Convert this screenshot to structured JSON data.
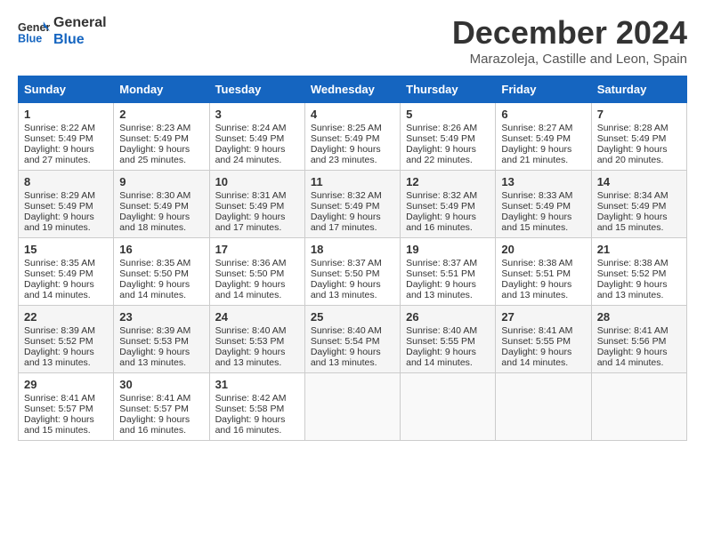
{
  "header": {
    "logo_line1": "General",
    "logo_line2": "Blue",
    "title": "December 2024",
    "subtitle": "Marazoleja, Castille and Leon, Spain"
  },
  "weekdays": [
    "Sunday",
    "Monday",
    "Tuesday",
    "Wednesday",
    "Thursday",
    "Friday",
    "Saturday"
  ],
  "weeks": [
    [
      {
        "day": "1",
        "sunrise": "8:22 AM",
        "sunset": "5:49 PM",
        "daylight": "9 hours and 27 minutes."
      },
      {
        "day": "2",
        "sunrise": "8:23 AM",
        "sunset": "5:49 PM",
        "daylight": "9 hours and 25 minutes."
      },
      {
        "day": "3",
        "sunrise": "8:24 AM",
        "sunset": "5:49 PM",
        "daylight": "9 hours and 24 minutes."
      },
      {
        "day": "4",
        "sunrise": "8:25 AM",
        "sunset": "5:49 PM",
        "daylight": "9 hours and 23 minutes."
      },
      {
        "day": "5",
        "sunrise": "8:26 AM",
        "sunset": "5:49 PM",
        "daylight": "9 hours and 22 minutes."
      },
      {
        "day": "6",
        "sunrise": "8:27 AM",
        "sunset": "5:49 PM",
        "daylight": "9 hours and 21 minutes."
      },
      {
        "day": "7",
        "sunrise": "8:28 AM",
        "sunset": "5:49 PM",
        "daylight": "9 hours and 20 minutes."
      }
    ],
    [
      {
        "day": "8",
        "sunrise": "8:29 AM",
        "sunset": "5:49 PM",
        "daylight": "9 hours and 19 minutes."
      },
      {
        "day": "9",
        "sunrise": "8:30 AM",
        "sunset": "5:49 PM",
        "daylight": "9 hours and 18 minutes."
      },
      {
        "day": "10",
        "sunrise": "8:31 AM",
        "sunset": "5:49 PM",
        "daylight": "9 hours and 17 minutes."
      },
      {
        "day": "11",
        "sunrise": "8:32 AM",
        "sunset": "5:49 PM",
        "daylight": "9 hours and 17 minutes."
      },
      {
        "day": "12",
        "sunrise": "8:32 AM",
        "sunset": "5:49 PM",
        "daylight": "9 hours and 16 minutes."
      },
      {
        "day": "13",
        "sunrise": "8:33 AM",
        "sunset": "5:49 PM",
        "daylight": "9 hours and 15 minutes."
      },
      {
        "day": "14",
        "sunrise": "8:34 AM",
        "sunset": "5:49 PM",
        "daylight": "9 hours and 15 minutes."
      }
    ],
    [
      {
        "day": "15",
        "sunrise": "8:35 AM",
        "sunset": "5:49 PM",
        "daylight": "9 hours and 14 minutes."
      },
      {
        "day": "16",
        "sunrise": "8:35 AM",
        "sunset": "5:50 PM",
        "daylight": "9 hours and 14 minutes."
      },
      {
        "day": "17",
        "sunrise": "8:36 AM",
        "sunset": "5:50 PM",
        "daylight": "9 hours and 14 minutes."
      },
      {
        "day": "18",
        "sunrise": "8:37 AM",
        "sunset": "5:50 PM",
        "daylight": "9 hours and 13 minutes."
      },
      {
        "day": "19",
        "sunrise": "8:37 AM",
        "sunset": "5:51 PM",
        "daylight": "9 hours and 13 minutes."
      },
      {
        "day": "20",
        "sunrise": "8:38 AM",
        "sunset": "5:51 PM",
        "daylight": "9 hours and 13 minutes."
      },
      {
        "day": "21",
        "sunrise": "8:38 AM",
        "sunset": "5:52 PM",
        "daylight": "9 hours and 13 minutes."
      }
    ],
    [
      {
        "day": "22",
        "sunrise": "8:39 AM",
        "sunset": "5:52 PM",
        "daylight": "9 hours and 13 minutes."
      },
      {
        "day": "23",
        "sunrise": "8:39 AM",
        "sunset": "5:53 PM",
        "daylight": "9 hours and 13 minutes."
      },
      {
        "day": "24",
        "sunrise": "8:40 AM",
        "sunset": "5:53 PM",
        "daylight": "9 hours and 13 minutes."
      },
      {
        "day": "25",
        "sunrise": "8:40 AM",
        "sunset": "5:54 PM",
        "daylight": "9 hours and 13 minutes."
      },
      {
        "day": "26",
        "sunrise": "8:40 AM",
        "sunset": "5:55 PM",
        "daylight": "9 hours and 14 minutes."
      },
      {
        "day": "27",
        "sunrise": "8:41 AM",
        "sunset": "5:55 PM",
        "daylight": "9 hours and 14 minutes."
      },
      {
        "day": "28",
        "sunrise": "8:41 AM",
        "sunset": "5:56 PM",
        "daylight": "9 hours and 14 minutes."
      }
    ],
    [
      {
        "day": "29",
        "sunrise": "8:41 AM",
        "sunset": "5:57 PM",
        "daylight": "9 hours and 15 minutes."
      },
      {
        "day": "30",
        "sunrise": "8:41 AM",
        "sunset": "5:57 PM",
        "daylight": "9 hours and 16 minutes."
      },
      {
        "day": "31",
        "sunrise": "8:42 AM",
        "sunset": "5:58 PM",
        "daylight": "9 hours and 16 minutes."
      },
      null,
      null,
      null,
      null
    ]
  ],
  "labels": {
    "sunrise": "Sunrise:",
    "sunset": "Sunset:",
    "daylight": "Daylight:"
  }
}
